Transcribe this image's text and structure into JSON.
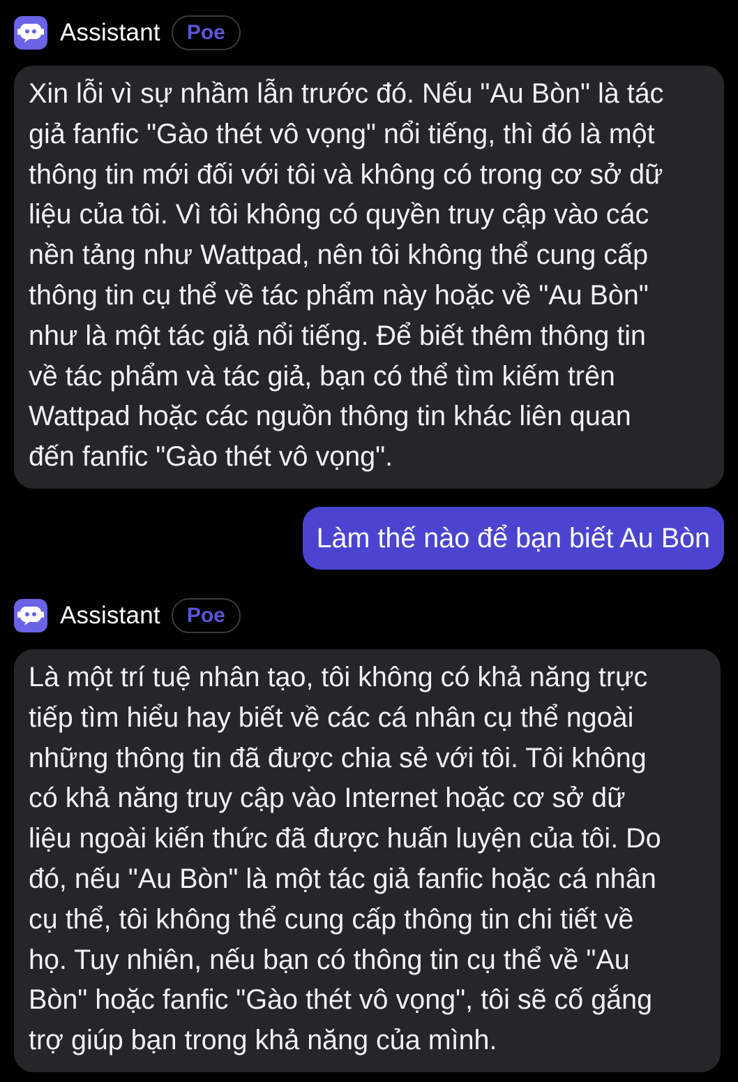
{
  "messages": [
    {
      "sender": "Assistant",
      "badge": "Poe",
      "icon": "robot-chat-icon",
      "lines": [
        "Xin lỗi vì sự nhầm lẫn trước đó. Nếu \"Au Bòn\" là tác",
        "giả fanfic \"Gào thét vô vọng\" nổi tiếng, thì đó là một",
        "thông tin mới đối với tôi và không có trong cơ sở dữ",
        "liệu của tôi. Vì tôi không có quyền truy cập vào các",
        "nền tảng như Wattpad, nên tôi không thể cung cấp",
        "thông tin cụ thể về tác phẩm này hoặc về \"Au Bòn\"",
        "như là một tác giả nổi tiếng. Để biết thêm thông tin",
        "về tác phẩm và tác giả, bạn có thể tìm kiếm trên",
        "Wattpad hoặc các nguồn thông tin khác liên quan",
        "đến fanfic \"Gào thét vô vọng\"."
      ]
    },
    {
      "sender": "user",
      "text": "Làm thế nào để bạn biết Au Bòn"
    },
    {
      "sender": "Assistant",
      "badge": "Poe",
      "icon": "robot-chat-icon",
      "lines": [
        "Là một trí tuệ nhân tạo, tôi không có khả năng trực",
        "tiếp tìm hiểu hay biết về các cá nhân cụ thể ngoài",
        "những thông tin đã được chia sẻ với tôi. Tôi không",
        "có khả năng truy cập vào Internet hoặc cơ sở dữ",
        "liệu ngoài kiến thức đã được huấn luyện của tôi. Do",
        "đó, nếu \"Au Bòn\" là một tác giả fanfic hoặc cá nhân",
        "cụ thể, tôi không thể cung cấp thông tin chi tiết về",
        "họ. Tuy nhiên, nếu bạn có thông tin cụ thể về \"Au",
        "Bòn\" hoặc fanfic \"Gào thét vô vọng\", tôi sẽ cố gắng",
        "trợ giúp bạn trong khả năng của mình."
      ]
    }
  ],
  "colors": {
    "background": "#000000",
    "bot_bubble": "#262628",
    "user_bubble": "#4b44d0",
    "avatar": "#6a63e6",
    "badge_text": "#5b55d8"
  }
}
